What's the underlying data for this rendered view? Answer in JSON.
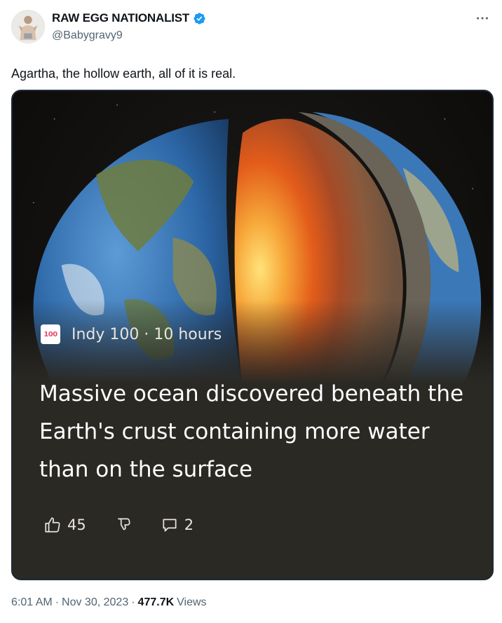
{
  "author": {
    "display_name": "RAW EGG NATIONALIST",
    "handle": "@Babygravy9",
    "verified_color": "#1d9bf0"
  },
  "tweet": {
    "text": "Agartha, the hollow earth, all of it is real."
  },
  "card": {
    "source_logo": "100",
    "source_name": "Indy 100 · 10 hours",
    "headline": "Massive ocean discovered beneath the Earth's crust containing more water than on the surface",
    "likes": "45",
    "comments": "2",
    "icons": [
      "thumbs-up-icon",
      "thumbs-down-icon",
      "comment-icon"
    ]
  },
  "meta": {
    "time": "6:01 AM",
    "separator": "·",
    "date": "Nov 30, 2023",
    "views_count": "477.7K",
    "views_label": "Views"
  }
}
